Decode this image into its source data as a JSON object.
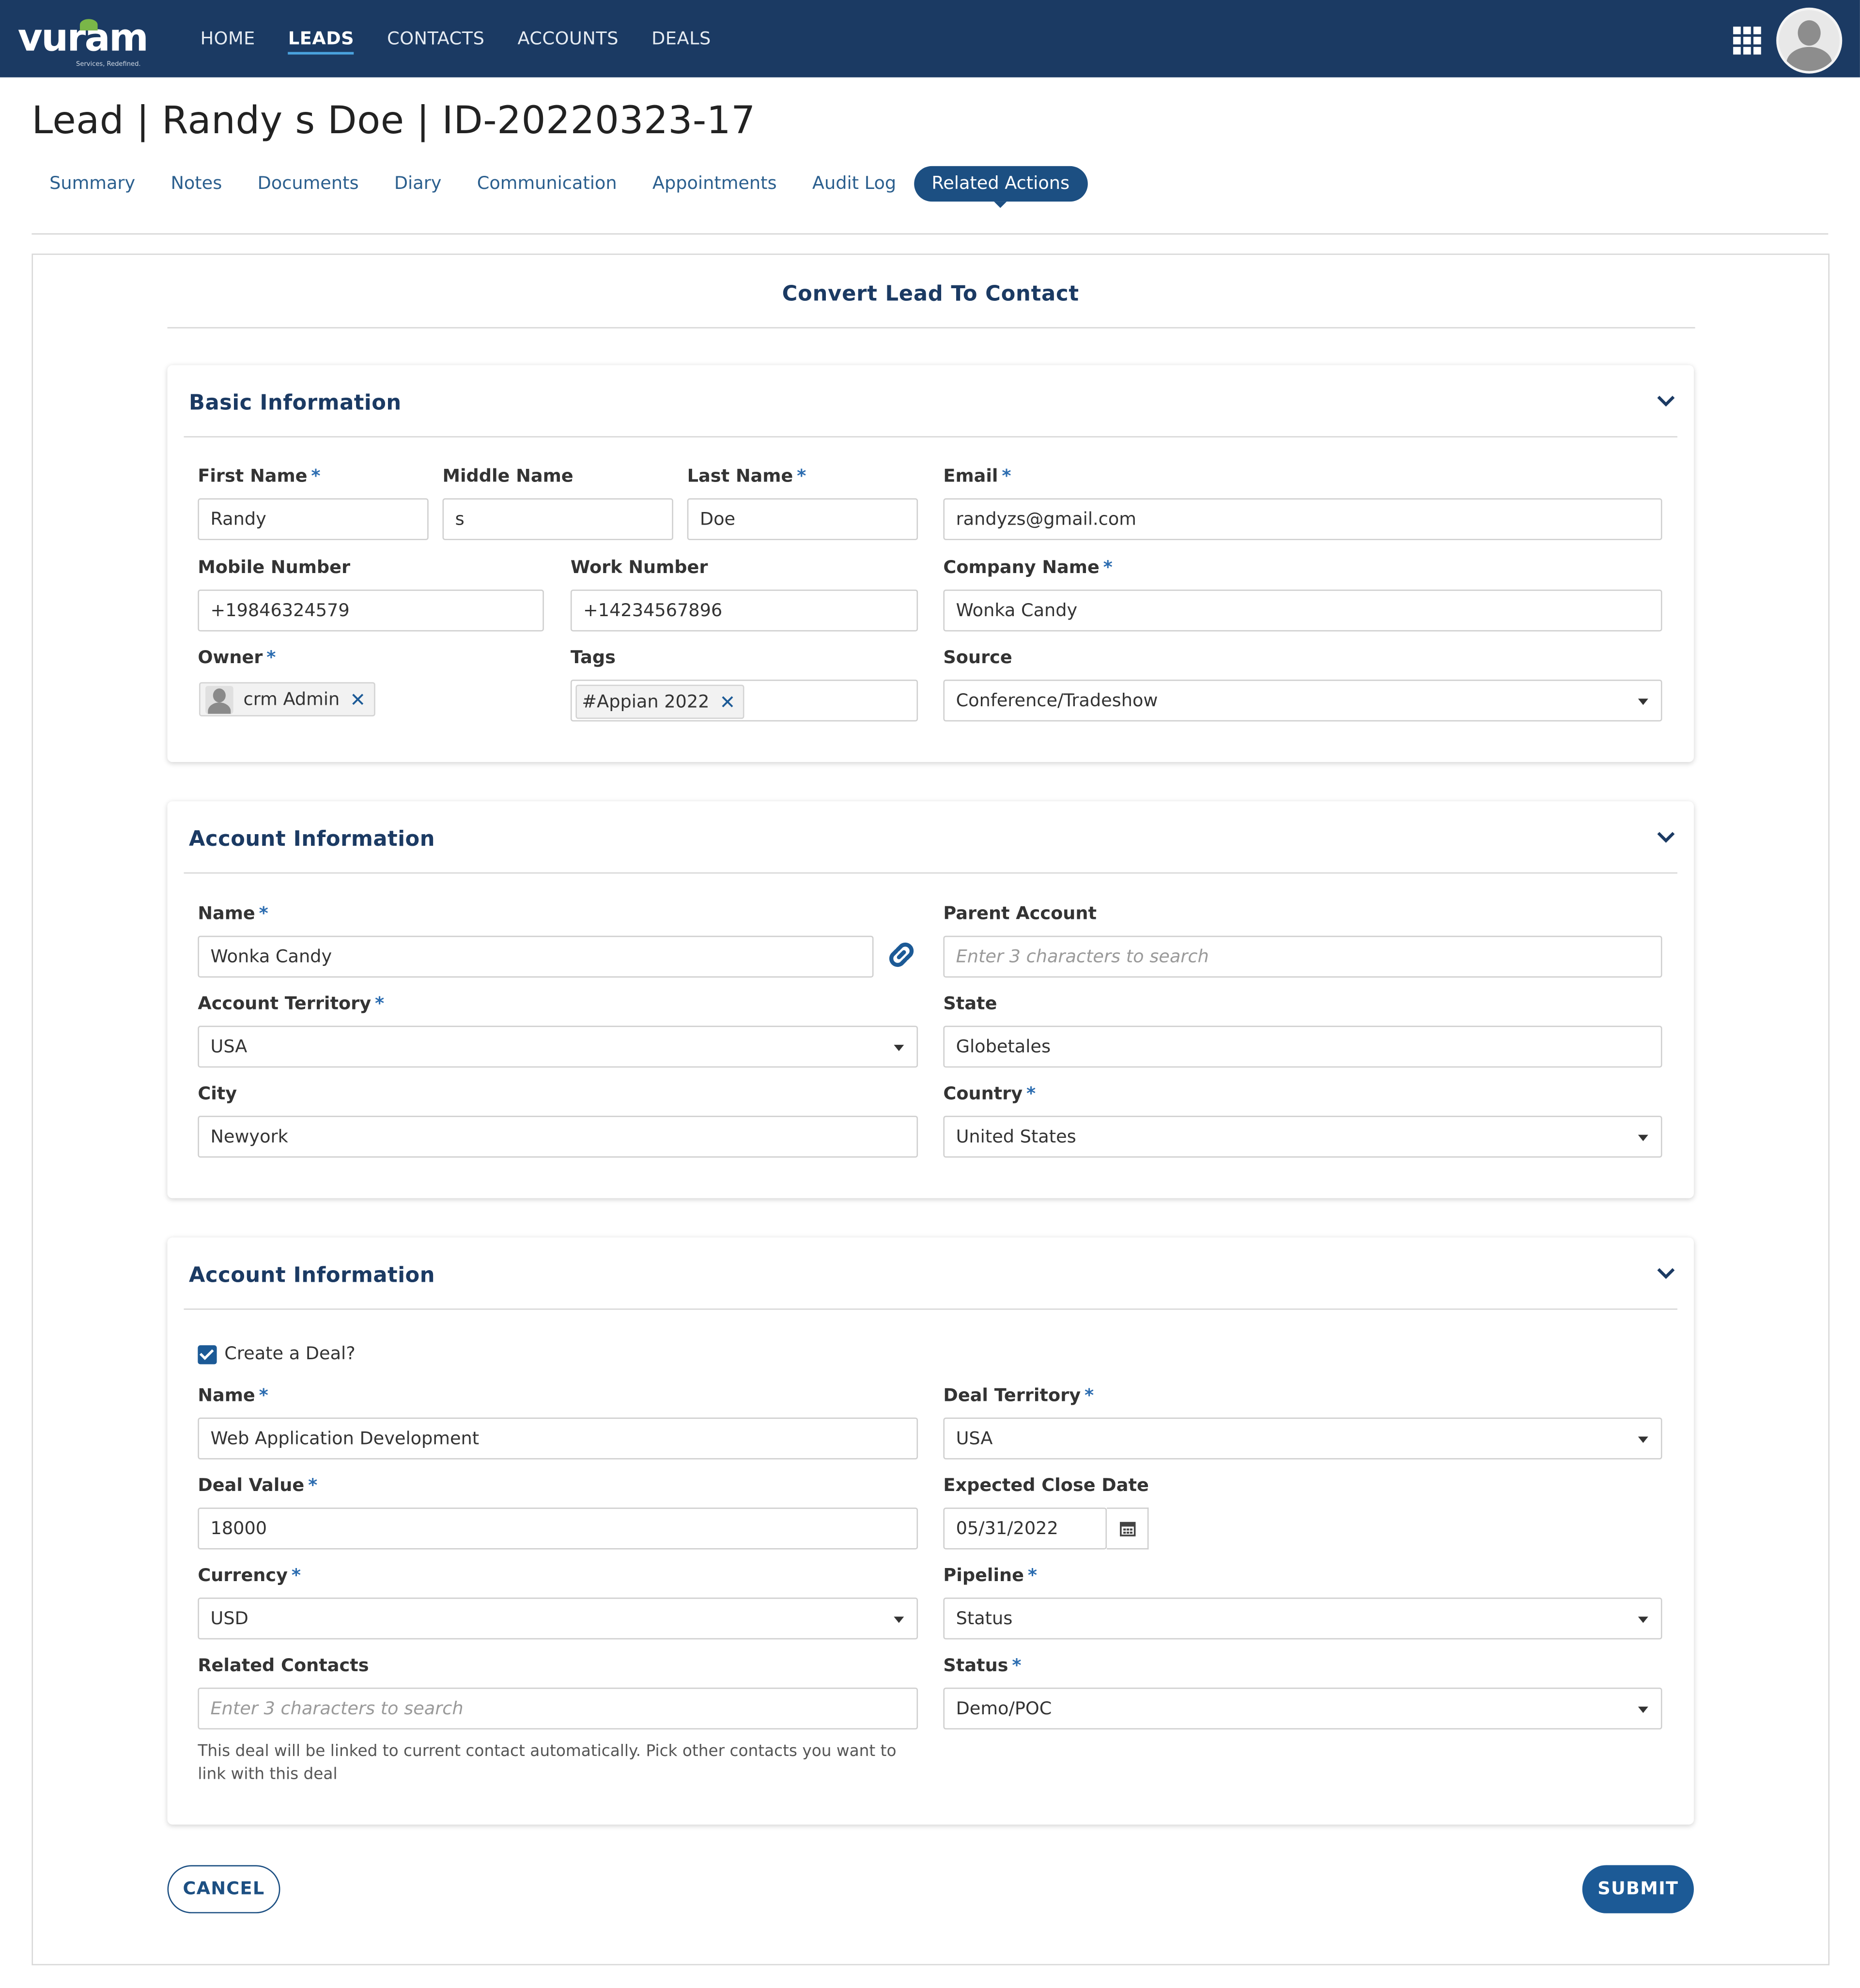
{
  "brand": {
    "name": "vuram",
    "tagline": "Services, Redefined."
  },
  "nav": {
    "items": [
      {
        "label": "HOME"
      },
      {
        "label": "LEADS"
      },
      {
        "label": "CONTACTS"
      },
      {
        "label": "ACCOUNTS"
      },
      {
        "label": "DEALS"
      }
    ],
    "active": "LEADS"
  },
  "page": {
    "title": "Lead | Randy s Doe | ID-20220323-17"
  },
  "tabs": [
    {
      "label": "Summary"
    },
    {
      "label": "Notes"
    },
    {
      "label": "Documents"
    },
    {
      "label": "Diary"
    },
    {
      "label": "Communication"
    },
    {
      "label": "Appointments"
    },
    {
      "label": "Audit Log"
    },
    {
      "label": "Related Actions"
    }
  ],
  "form": {
    "title": "Convert Lead To Contact",
    "basic": {
      "heading": "Basic Information",
      "first_name": {
        "label": "First Name",
        "value": "Randy"
      },
      "middle_name": {
        "label": "Middle Name",
        "value": "s"
      },
      "last_name": {
        "label": "Last Name",
        "value": "Doe"
      },
      "email": {
        "label": "Email",
        "value": "randyzs@gmail.com"
      },
      "mobile": {
        "label": "Mobile Number",
        "value": "+19846324579"
      },
      "work": {
        "label": "Work Number",
        "value": "+14234567896"
      },
      "company": {
        "label": "Company Name",
        "value": "Wonka Candy"
      },
      "owner": {
        "label": "Owner",
        "value": "crm Admin"
      },
      "tags": {
        "label": "Tags",
        "value": "#Appian 2022"
      },
      "source": {
        "label": "Source",
        "value": "Conference/Tradeshow"
      }
    },
    "account": {
      "heading": "Account Information",
      "name": {
        "label": "Name",
        "value": "Wonka Candy"
      },
      "parent": {
        "label": "Parent Account",
        "placeholder": "Enter 3 characters to search"
      },
      "territory": {
        "label": "Account Territory",
        "value": "USA"
      },
      "state": {
        "label": "State",
        "value": "Globetales"
      },
      "city": {
        "label": "City",
        "value": "Newyork"
      },
      "country": {
        "label": "Country",
        "value": "United States"
      }
    },
    "deal": {
      "heading": "Account Information",
      "create_deal": {
        "label": "Create a Deal?",
        "checked": true
      },
      "name": {
        "label": "Name",
        "value": "Web Application Development"
      },
      "territory": {
        "label": "Deal Territory",
        "value": "USA"
      },
      "value": {
        "label": "Deal Value",
        "value": "18000"
      },
      "close_date": {
        "label": "Expected Close Date",
        "value": "05/31/2022"
      },
      "currency": {
        "label": "Currency",
        "value": "USD"
      },
      "pipeline": {
        "label": "Pipeline",
        "value": "Status"
      },
      "related": {
        "label": "Related Contacts",
        "placeholder": "Enter 3 characters to search",
        "help": "This deal will be linked to current contact automatically. Pick other contacts you want to link with this deal"
      },
      "status": {
        "label": "Status",
        "value": "Demo/POC"
      }
    },
    "buttons": {
      "cancel": "CANCEL",
      "submit": "SUBMIT"
    }
  },
  "required_marker": "*",
  "remove_marker": "✕",
  "colors": {
    "nav_bg": "#1b3a63",
    "accent": "#1c5a96",
    "required": "#2b6cb0"
  },
  "icons": [
    "apps-grid-icon",
    "user-avatar-icon",
    "chevron-down-icon",
    "link-icon",
    "calendar-icon",
    "remove-icon",
    "dropdown-caret-icon",
    "checkbox-checked-icon"
  ]
}
